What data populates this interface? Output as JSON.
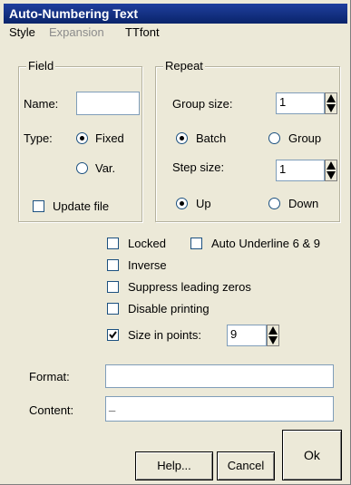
{
  "window": {
    "title": "Auto-Numbering Text"
  },
  "menu": {
    "items": [
      {
        "label": "Style",
        "enabled": true
      },
      {
        "label": "Expansion",
        "enabled": false
      },
      {
        "label": "TTfont",
        "enabled": true
      }
    ]
  },
  "field": {
    "legend": "Field",
    "name_label": "Name:",
    "name_value": "",
    "type_label": "Type:",
    "type_options": [
      {
        "label": "Fixed",
        "selected": true
      },
      {
        "label": "Var.",
        "selected": false
      }
    ],
    "update_file_label": "Update file",
    "update_file_checked": false
  },
  "repeat": {
    "legend": "Repeat",
    "group_size_label": "Group size:",
    "group_size_value": "1",
    "mode_options": [
      {
        "label": "Batch",
        "selected": true
      },
      {
        "label": "Group",
        "selected": false
      }
    ],
    "step_size_label": "Step size:",
    "step_size_value": "1",
    "direction_options": [
      {
        "label": "Up",
        "selected": true
      },
      {
        "label": "Down",
        "selected": false
      }
    ]
  },
  "options": {
    "locked": {
      "label": "Locked",
      "checked": false
    },
    "auto_underline": {
      "label": "Auto Underline 6 & 9",
      "checked": false
    },
    "inverse": {
      "label": "Inverse",
      "checked": false
    },
    "suppress_zeros": {
      "label": "Suppress leading zeros",
      "checked": false
    },
    "disable_printing": {
      "label": "Disable printing",
      "checked": false
    },
    "size_in_points": {
      "label": "Size in points:",
      "checked": true,
      "value": "9"
    }
  },
  "format": {
    "label": "Format:",
    "value": ""
  },
  "content": {
    "label": "Content:",
    "value": "_"
  },
  "buttons": {
    "help": "Help...",
    "cancel": "Cancel",
    "ok": "Ok"
  },
  "colors": {
    "titlebar": "#0a246a",
    "dialog_bg": "#ece9d8",
    "input_border": "#7f9db9"
  }
}
